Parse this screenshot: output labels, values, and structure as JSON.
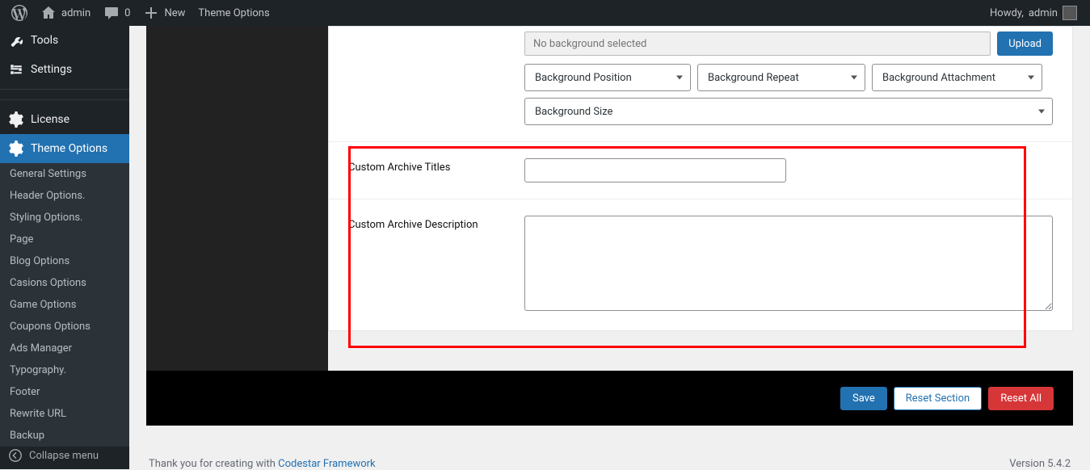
{
  "adminbar": {
    "site": "admin",
    "comments": "0",
    "new": "New",
    "page_title": "Theme Options",
    "howdy_prefix": "Howdy, ",
    "howdy_user": "admin"
  },
  "sidebar": {
    "tools": "Tools",
    "settings": "Settings",
    "license": "License",
    "theme_options": "Theme Options",
    "collapse": "Collapse menu"
  },
  "submenu": {
    "items": [
      "General Settings",
      "Header Options.",
      "Styling Options.",
      "Page",
      "Blog Options",
      "Casions Options",
      "Game Options",
      "Coupons Options",
      "Ads Manager",
      "Typography.",
      "Footer",
      "Rewrite URL",
      "Backup"
    ]
  },
  "fields": {
    "bg_placeholder": "No background selected",
    "upload": "Upload",
    "bg_position": "Background Position",
    "bg_repeat": "Background Repeat",
    "bg_attach": "Background Attachment",
    "bg_size": "Background Size",
    "archive_titles_label": "Custom Archive Titles",
    "archive_desc_label": "Custom Archive Description"
  },
  "footer_buttons": {
    "save": "Save",
    "reset_section": "Reset Section",
    "reset_all": "Reset All"
  },
  "wp_footer": {
    "thank_pre": "Thank you for creating with ",
    "thank_link": "Codestar Framework",
    "version": "Version 5.4.2"
  }
}
